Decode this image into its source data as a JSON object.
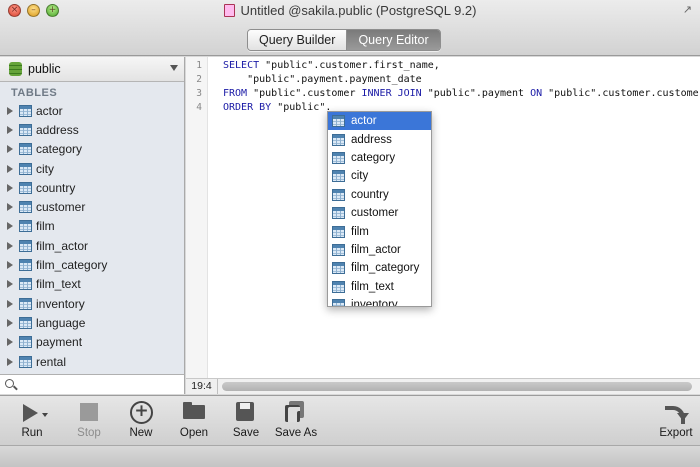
{
  "window": {
    "title": "Untitled @sakila.public (PostgreSQL 9.2)",
    "close_glyph": "×",
    "minimize_glyph": "–",
    "zoom_glyph": "+",
    "fullscreen_glyph": "↗"
  },
  "mode_tabs": [
    {
      "label": "Query Builder",
      "active": false
    },
    {
      "label": "Query Editor",
      "active": true
    }
  ],
  "sidebar": {
    "schema": "public",
    "section_title": "TABLES",
    "tables": [
      "actor",
      "address",
      "category",
      "city",
      "country",
      "customer",
      "film",
      "film_actor",
      "film_category",
      "film_text",
      "inventory",
      "language",
      "payment",
      "rental"
    ],
    "search_placeholder": ""
  },
  "editor": {
    "line_numbers": [
      "1",
      "2",
      "3",
      "4"
    ],
    "lines": [
      [
        {
          "t": "SELECT ",
          "k": true
        },
        {
          "t": "\"public\".customer.first_name,",
          "k": false
        }
      ],
      [
        {
          "t": "    \"public\".payment.payment_date",
          "k": false
        }
      ],
      [
        {
          "t": "FROM ",
          "k": true
        },
        {
          "t": "\"public\".customer ",
          "k": false
        },
        {
          "t": "INNER JOIN ",
          "k": true
        },
        {
          "t": "\"public\".payment ",
          "k": false
        },
        {
          "t": "ON ",
          "k": true
        },
        {
          "t": "\"public\".customer.customer_id",
          "k": false
        }
      ],
      [
        {
          "t": "ORDER BY ",
          "k": true
        },
        {
          "t": "\"public\".",
          "k": false
        }
      ]
    ],
    "cursor_position": "19:4"
  },
  "autocomplete": {
    "items": [
      "actor",
      "address",
      "category",
      "city",
      "country",
      "customer",
      "film",
      "film_actor",
      "film_category",
      "film_text",
      "inventory"
    ],
    "selected_index": 0
  },
  "toolbar": {
    "run": "Run",
    "stop": "Stop",
    "new": "New",
    "open": "Open",
    "save": "Save",
    "save_as": "Save As",
    "export": "Export"
  },
  "icons": [
    "table-icon",
    "database-icon",
    "run-icon",
    "stop-icon",
    "new-icon",
    "open-folder-icon",
    "save-icon",
    "save-as-icon",
    "export-icon",
    "search-icon"
  ],
  "colors": {
    "selection": "#3b76d8",
    "keyword": "#1a1aa6",
    "active_tab": "#8a8a8a"
  }
}
